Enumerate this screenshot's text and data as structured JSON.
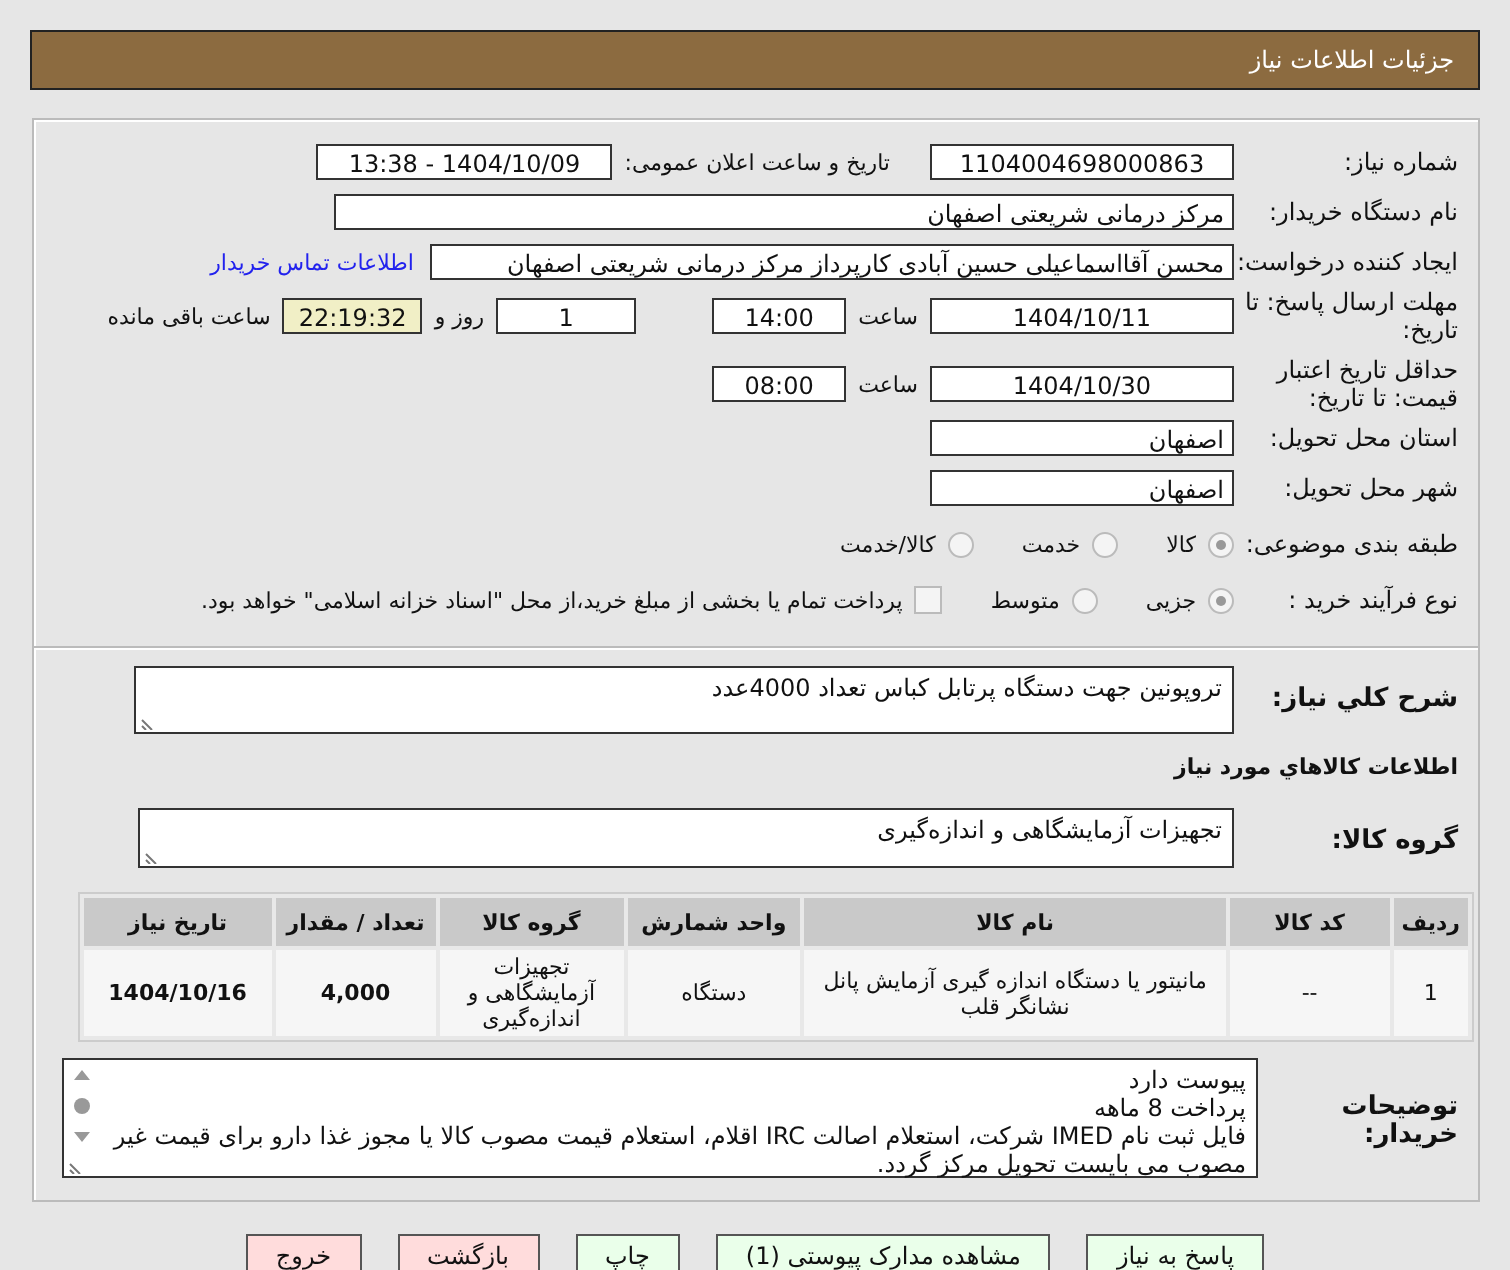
{
  "header": {
    "title": "جزئیات اطلاعات نیاز"
  },
  "need_number": {
    "label": "شماره نیاز:",
    "value": "1104004698000863"
  },
  "announce": {
    "label": "تاریخ و ساعت اعلان عمومی:",
    "value": "1404/10/09 - 13:38"
  },
  "buyer": {
    "label": "نام دستگاه خریدار:",
    "value": "مرکز درمانی شریعتی اصفهان"
  },
  "creator": {
    "label": "ایجاد کننده درخواست:",
    "value": "محسن آقااسماعیلی حسین آبادی کارپرداز مرکز درمانی شریعتی اصفهان",
    "link": "اطلاعات تماس خریدار"
  },
  "deadline": {
    "label": "مهلت ارسال پاسخ: تا تاریخ:",
    "date": "1404/10/11",
    "time_label": "ساعت",
    "time": "14:00",
    "days": "1",
    "days_label": "روز و",
    "remaining": "22:19:32",
    "remaining_label": "ساعت باقی مانده"
  },
  "validity": {
    "label": "حداقل تاریخ اعتبار قیمت: تا تاریخ:",
    "date": "1404/10/30",
    "time_label": "ساعت",
    "time": "08:00"
  },
  "province": {
    "label": "استان محل تحویل:",
    "value": "اصفهان"
  },
  "city": {
    "label": "شهر محل تحویل:",
    "value": "اصفهان"
  },
  "category": {
    "label": "طبقه بندی موضوعی:",
    "options": [
      {
        "label": "کالا",
        "selected": true
      },
      {
        "label": "خدمت",
        "selected": false
      },
      {
        "label": "کالا/خدمت",
        "selected": false
      }
    ]
  },
  "process": {
    "label": "نوع فرآیند خرید :",
    "options": [
      {
        "label": "جزیی",
        "selected": true
      },
      {
        "label": "متوسط",
        "selected": false
      }
    ],
    "payment": {
      "label": "پرداخت تمام یا بخشی از مبلغ خرید،از محل \"اسناد خزانه اسلامی\" خواهد بود.",
      "checked": false
    }
  },
  "description": {
    "label": "شرح کلي نياز:",
    "value": "تروپونین جهت دستگاه پرتابل کباس تعداد 4000عدد"
  },
  "goods_title": "اطلاعات کالاهاي مورد نياز",
  "goods_group": {
    "label": "گروه کالا:",
    "value": "تجهیزات آزمایشگاهی و اندازه‌گیری"
  },
  "table": {
    "columns": [
      "ردیف",
      "کد کالا",
      "نام کالا",
      "واحد شمارش",
      "گروه کالا",
      "تعداد / مقدار",
      "تاریخ نیاز"
    ],
    "rows": [
      [
        "1",
        "--",
        "مانیتور یا دستگاه اندازه گیری آزمایش پانل نشانگر قلب",
        "دستگاه",
        "تجهیزات آزمایشگاهی و اندازه‌گیری",
        "4,000",
        "1404/10/16"
      ]
    ]
  },
  "notes": {
    "label": "توضیحات خریدار:",
    "lines": [
      "پیوست دارد",
      "پرداخت 8 ماهه",
      "فایل ثبت نام IMED شرکت، استعلام اصالت IRC اقلام، استعلام قیمت مصوب کالا یا مجوز غذا دارو برای قیمت غیر مصوب می بایست تحویل مرکز گردد."
    ]
  },
  "buttons": [
    {
      "label": "پاسخ به نیاز",
      "kind": "go"
    },
    {
      "label": "مشاهده مدارک پیوستی (1)",
      "kind": "go"
    },
    {
      "label": "چاپ",
      "kind": "go"
    },
    {
      "label": "بازگشت",
      "kind": "stop"
    },
    {
      "label": "خروج",
      "kind": "stop"
    }
  ]
}
